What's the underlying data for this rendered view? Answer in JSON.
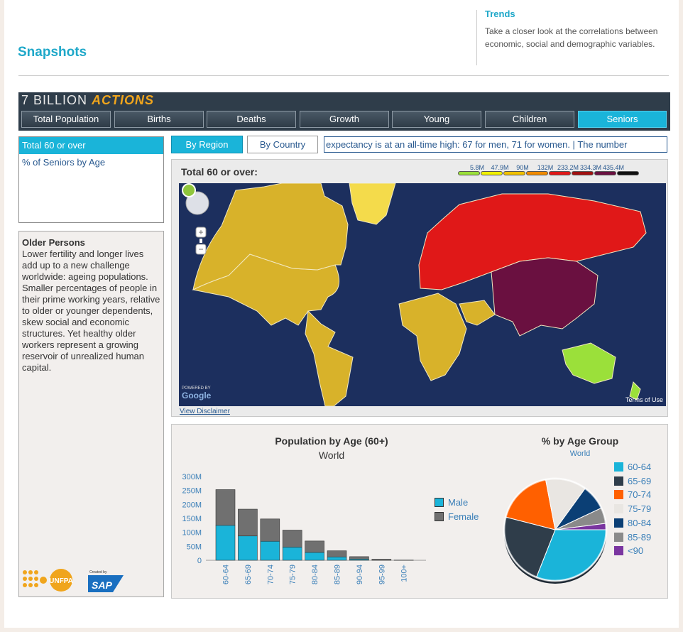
{
  "header": {
    "title": "Snapshots",
    "trends_title": "Trends",
    "trends_desc": "Take a closer look at the correlations between economic, social and demographic variables."
  },
  "app": {
    "brand_first": "7 BILLION",
    "brand_second": "ACTIONS",
    "tabs": [
      "Total Population",
      "Births",
      "Deaths",
      "Growth",
      "Young",
      "Children",
      "Seniors"
    ],
    "active_tab": "Seniors"
  },
  "sidebar": {
    "items": [
      {
        "label": "Total 60 or over"
      },
      {
        "label": "% of Seniors by Age"
      }
    ],
    "active_item": "Total 60 or over"
  },
  "info": {
    "title": "Older Persons",
    "text": "Lower fertility and longer lives add up to a new challenge worldwide: ageing populations. Smaller percentages of people in their prime working years, relative to older or younger dependents, skew social and economic structures. Yet healthy older workers represent a growing reservoir of unrealized human capital.",
    "logo_unfpa": "UNFPA",
    "logo_createdby": "Created by",
    "logo_sap": "SAP"
  },
  "controls": {
    "by_region": "By Region",
    "by_country": "By Country",
    "ticker": "expectancy is at an all-time high: 67 for men, 71 for women.   |   The number"
  },
  "map": {
    "title": "Total 60 or over:",
    "legend": [
      {
        "value": "5.8M",
        "color": "#9be03a"
      },
      {
        "value": "47.9M",
        "color": "#f0f000"
      },
      {
        "value": "90M",
        "color": "#f0c000"
      },
      {
        "value": "132M",
        "color": "#f08a00"
      },
      {
        "value": "233.2M",
        "color": "#e01818"
      },
      {
        "value": "334.3M",
        "color": "#a01010"
      },
      {
        "value": "435.4M",
        "color": "#6a1040"
      },
      {
        "value": "",
        "color": "#111111"
      }
    ],
    "powered_by": "POWERED BY",
    "google": "Google",
    "terms": "Terms of Use",
    "disclaimer": "View Disclaimer"
  },
  "colors": {
    "accent": "#1ab4d9",
    "male": "#1ab4d9",
    "female": "#707070",
    "ocean": "#1c2f5e"
  },
  "chart_data": [
    {
      "type": "bar",
      "title": "Population by Age (60+)",
      "subtitle": "World",
      "categories": [
        "60-64",
        "65-69",
        "70-74",
        "75-79",
        "80-84",
        "85-89",
        "90-94",
        "95-99",
        "100+"
      ],
      "stacked": true,
      "series": [
        {
          "name": "Male",
          "values": [
            125,
            87,
            68,
            47,
            28,
            12,
            4,
            1,
            0.2
          ]
        },
        {
          "name": "Female",
          "values": [
            128,
            96,
            80,
            61,
            41,
            22,
            9,
            2.5,
            0.6
          ]
        }
      ],
      "ylim": [
        0,
        300
      ],
      "yticks": [
        "0",
        "50M",
        "100M",
        "150M",
        "200M",
        "250M",
        "300M"
      ],
      "legend": "right"
    },
    {
      "type": "pie",
      "title": "% by Age Group",
      "subtitle": "World",
      "labels": [
        "60-64",
        "65-69",
        "70-74",
        "75-79",
        "80-84",
        "85-89",
        "<90"
      ],
      "values": [
        31,
        23,
        18,
        13,
        8,
        5,
        2
      ],
      "colors": [
        "#1ab4d9",
        "#2f3d4a",
        "#ff6000",
        "#e9e6e2",
        "#0b3f75",
        "#8a8a8a",
        "#7a35a0"
      ],
      "legend": "right"
    }
  ]
}
